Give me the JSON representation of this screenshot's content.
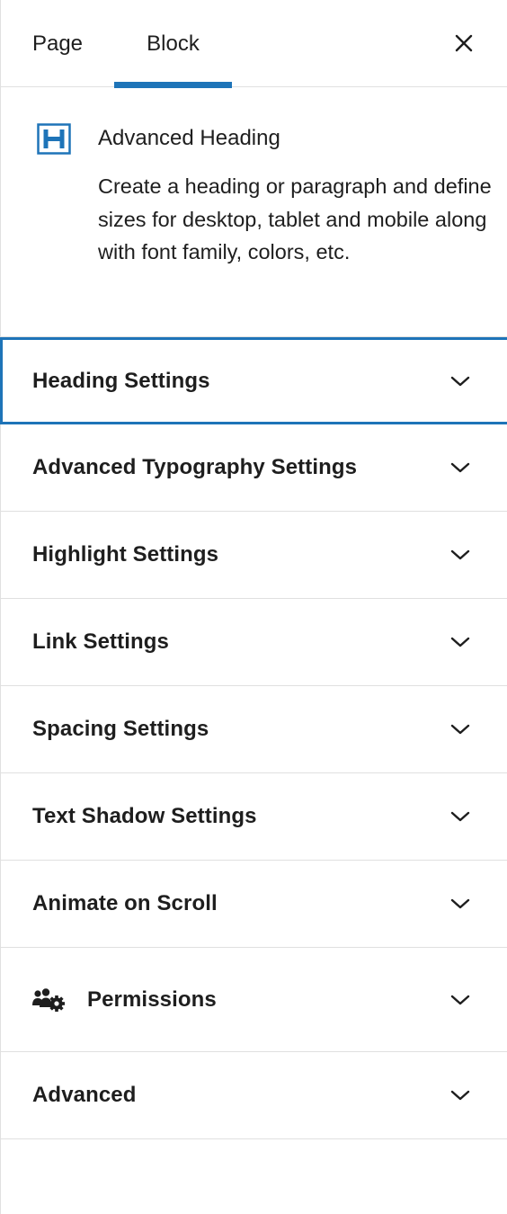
{
  "tabs": {
    "page_label": "Page",
    "block_label": "Block",
    "active": "Block"
  },
  "block": {
    "icon": "heading-h-icon",
    "title": "Advanced Heading",
    "description": "Create a heading or paragraph and define sizes for desktop, tablet and mobile along with font family, colors, etc."
  },
  "panels": [
    {
      "label": "Heading Settings",
      "icon": "chevron-down-icon"
    },
    {
      "label": "Advanced Typography Settings",
      "icon": "chevron-down-icon"
    },
    {
      "label": "Highlight Settings",
      "icon": "chevron-down-icon"
    },
    {
      "label": "Link Settings",
      "icon": "chevron-down-icon"
    },
    {
      "label": "Spacing Settings",
      "icon": "chevron-down-icon"
    },
    {
      "label": "Text Shadow Settings",
      "icon": "chevron-down-icon"
    },
    {
      "label": "Animate on Scroll",
      "icon": "chevron-down-icon"
    },
    {
      "label": "Permissions",
      "icon": "users-gear-icon"
    },
    {
      "label": "Advanced",
      "icon": "chevron-down-icon"
    }
  ],
  "colors": {
    "accent": "#1e74b8",
    "text": "#1e1e1e",
    "divider": "#e0e0e0"
  }
}
